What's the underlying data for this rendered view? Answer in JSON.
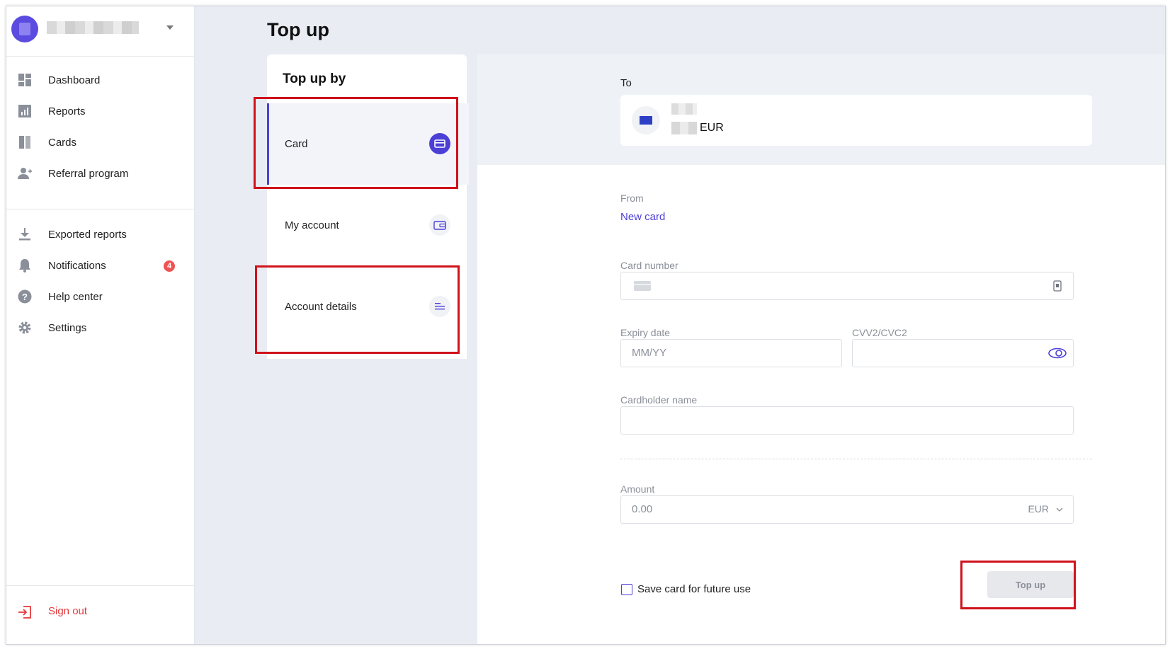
{
  "sidebar": {
    "nav": [
      {
        "label": "Dashboard",
        "icon": "dashboard-icon"
      },
      {
        "label": "Reports",
        "icon": "reports-icon"
      },
      {
        "label": "Cards",
        "icon": "cards-icon"
      },
      {
        "label": "Referral program",
        "icon": "add-user-icon"
      }
    ],
    "nav2": [
      {
        "label": "Exported reports",
        "icon": "download-icon"
      },
      {
        "label": "Notifications",
        "icon": "bell-icon",
        "badge": "4"
      },
      {
        "label": "Help center",
        "icon": "help-icon"
      },
      {
        "label": "Settings",
        "icon": "gear-icon"
      }
    ],
    "signout": "Sign out"
  },
  "page": {
    "title": "Top up"
  },
  "topup_by": {
    "title": "Top up by",
    "options": [
      {
        "label": "Card",
        "icon": "card-icon"
      },
      {
        "label": "My account",
        "icon": "wallet-icon"
      },
      {
        "label": "Account details",
        "icon": "list-icon"
      }
    ]
  },
  "to": {
    "label": "To",
    "currency": "EUR"
  },
  "from": {
    "label": "From",
    "value": "New card"
  },
  "form": {
    "card_number_label": "Card number",
    "expiry_label": "Expiry date",
    "expiry_placeholder": "MM/YY",
    "cvv_label": "CVV2/CVC2",
    "cardholder_label": "Cardholder name",
    "amount_label": "Amount",
    "amount_placeholder": "0.00",
    "amount_currency": "EUR",
    "save_card_label": "Save card for future use",
    "submit_label": "Top up"
  },
  "colors": {
    "accent": "#4c3fd6",
    "highlight": "#d0121b",
    "danger": "#e5383b"
  }
}
